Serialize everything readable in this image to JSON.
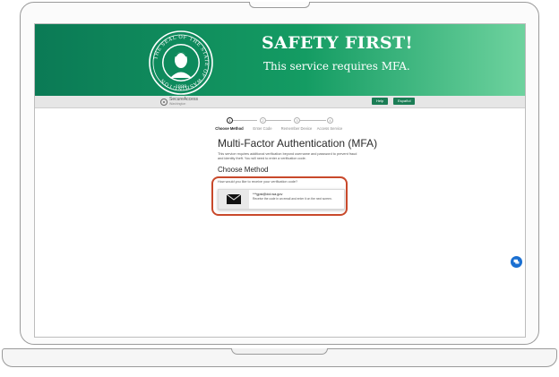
{
  "banner": {
    "title": "SAFETY FIRST!",
    "subtitle": "This service requires MFA.",
    "seal_text": "THE SEAL OF THE STATE OF WASHINGTON",
    "seal_year": "1889"
  },
  "nav": {
    "brand_name": "SecureAccess",
    "brand_sub": "Washington",
    "help_label": "Help",
    "language_label": "Español"
  },
  "stepper": {
    "steps": [
      {
        "number": "1",
        "label": "Choose Method"
      },
      {
        "number": "2",
        "label": "Enter Code"
      },
      {
        "number": "3",
        "label": "Remember Device"
      },
      {
        "number": "4",
        "label": "Access Service"
      }
    ],
    "active_index": 0
  },
  "main": {
    "title": "Multi-Factor Authentication (MFA)",
    "intro": "This service requires additional verification beyond username and password to prevent fraud and identity theft. You will need to enter a verification code.",
    "section_title": "Choose Method",
    "prompt": "How would you like to receive your verification code?",
    "method": {
      "icon": "envelope-icon",
      "email": "***gpsi@dol.wa.gov",
      "description": "Receive the code in an email and enter it on the next screen."
    }
  },
  "colors": {
    "banner_green": "#0b7a55",
    "highlight": "#c8492b",
    "chat_blue": "#1a6fd1"
  }
}
